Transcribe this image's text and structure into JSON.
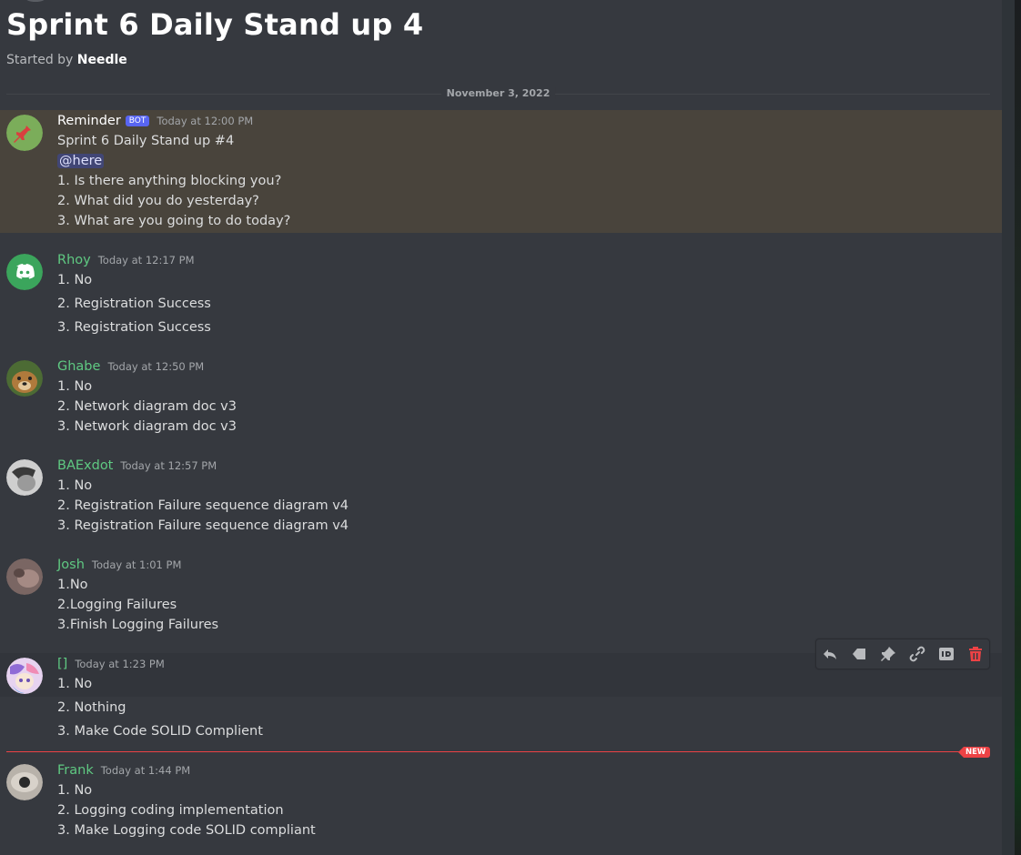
{
  "thread": {
    "title": "Sprint 6 Daily Stand up 4",
    "started_by_label": "Started by",
    "started_by_user": "Needle"
  },
  "date_divider": "November 3, 2022",
  "messages": [
    {
      "author": "Reminder",
      "bot_tag": "BOT",
      "timestamp": "Today at 12:00 PM",
      "lines": [
        "Sprint 6 Daily Stand up #4",
        "@here",
        "1. Is there anything blocking you?",
        "2. What did you do yesterday?",
        "3. What are you going to do today?"
      ]
    },
    {
      "author": "Rhoy",
      "timestamp": "Today at 12:17 PM",
      "lines": [
        "1. No",
        "2. Registration Success",
        "3. Registration Success"
      ]
    },
    {
      "author": "Ghabe",
      "timestamp": "Today at 12:50 PM",
      "lines": [
        "1. No",
        "2. Network diagram doc v3",
        "3. Network diagram doc v3"
      ]
    },
    {
      "author": "BAExdot",
      "timestamp": "Today at 12:57 PM",
      "lines": [
        "1. No",
        "2. Registration Failure sequence diagram v4",
        "3. Registration Failure sequence diagram v4"
      ]
    },
    {
      "author": "Josh",
      "timestamp": "Today at 1:01 PM",
      "lines": [
        "1.No",
        "2.Logging Failures",
        "3.Finish Logging Failures"
      ]
    },
    {
      "author": "[]",
      "timestamp": "Today at 1:23 PM",
      "lines": [
        "1. No",
        "2. Nothing",
        "3. Make Code SOLID Complient"
      ]
    },
    {
      "author": "Frank",
      "timestamp": "Today at 1:44 PM",
      "lines": [
        "1. No",
        "2. Logging coding implementation",
        "3. Make Logging code SOLID compliant"
      ]
    }
  ],
  "new_marker": "NEW",
  "toolbar_icons": [
    "reply-icon",
    "mark-unread-icon",
    "pin-icon",
    "copy-link-icon",
    "copy-id-icon",
    "delete-icon"
  ],
  "colors": {
    "background": "#36393f",
    "username_green": "#5fc982",
    "bot_tag": "#5865f2",
    "new_line": "#ed4245",
    "highlight": "#49443c",
    "mention_bg": "#414675"
  }
}
